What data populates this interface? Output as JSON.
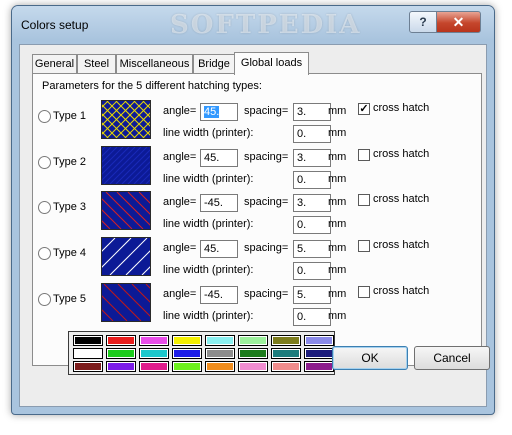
{
  "window": {
    "title": "Colors setup",
    "watermark": "SOFTPEDIA",
    "help_glyph": "?",
    "close_glyph": "✕"
  },
  "tabs": [
    {
      "label": "General",
      "active": false
    },
    {
      "label": "Steel",
      "active": false
    },
    {
      "label": "Miscellaneous",
      "active": false
    },
    {
      "label": "Bridge",
      "active": false
    },
    {
      "label": "Global loads",
      "active": true
    }
  ],
  "panel": {
    "heading": "Parameters for the 5 different hatching types:",
    "angle_label": "angle=",
    "spacing_label": "spacing=",
    "mm_label": "mm",
    "line_width_label": "line width (printer):",
    "cross_hatch_label": "cross hatch",
    "types": [
      {
        "label": "Type 1",
        "angle": "45.",
        "spacing": "3.",
        "line_width": "0.",
        "cross_hatch": true,
        "selected": false
      },
      {
        "label": "Type 2",
        "angle": "45.",
        "spacing": "3.",
        "line_width": "0.",
        "cross_hatch": false,
        "selected": false
      },
      {
        "label": "Type 3",
        "angle": "-45.",
        "spacing": "3.",
        "line_width": "0.",
        "cross_hatch": false,
        "selected": false
      },
      {
        "label": "Type 4",
        "angle": "45.",
        "spacing": "5.",
        "line_width": "0.",
        "cross_hatch": false,
        "selected": false
      },
      {
        "label": "Type 5",
        "angle": "-45.",
        "spacing": "5.",
        "line_width": "0.",
        "cross_hatch": false,
        "selected": false
      }
    ],
    "swatch_background": "#0c1a96",
    "check_mark": "✓",
    "palette": [
      [
        "#000000",
        "#e81c1c",
        "#e84ce8",
        "#f4f000",
        "#8af0f0",
        "#9cf09c",
        "#7c7c1c",
        "#8a8ae8"
      ],
      [
        "#ffffff",
        "#1ccc1c",
        "#1cc8cc",
        "#1c1ce8",
        "#8c8c8c",
        "#1c7c1c",
        "#1c7c7c",
        "#1c1c7c"
      ],
      [
        "#7c1c1c",
        "#7c1ce8",
        "#e01c8c",
        "#6cf01c",
        "#f08c1c",
        "#f08cd0",
        "#f08c8c",
        "#8c1c8c"
      ]
    ]
  },
  "buttons": {
    "ok": "OK",
    "cancel": "Cancel"
  }
}
